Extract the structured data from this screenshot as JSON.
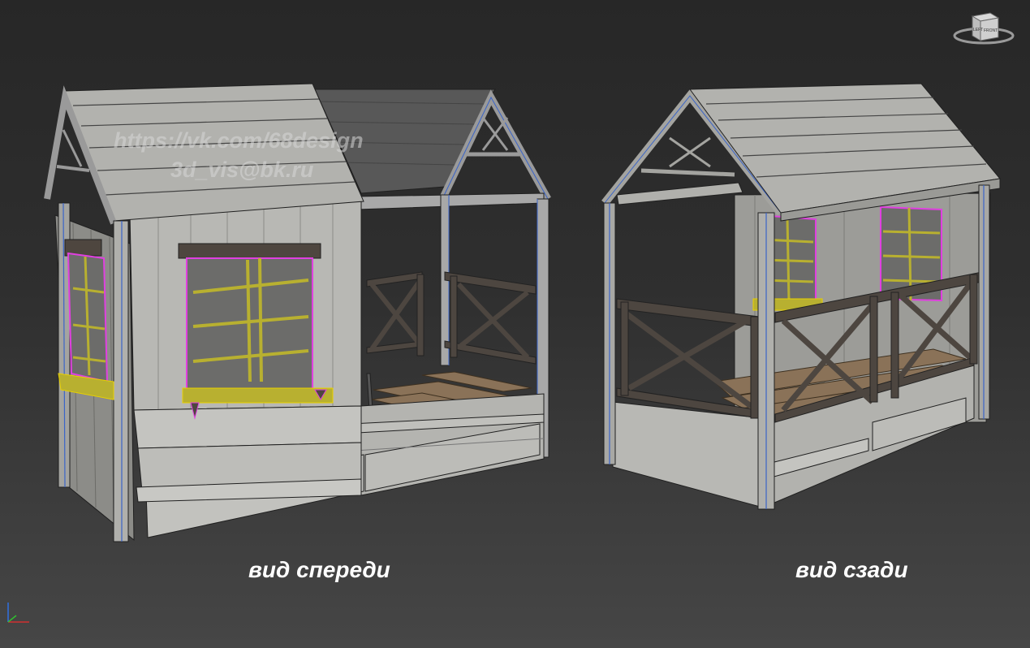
{
  "viewport": {
    "background_top": "#272727",
    "background_bottom": "#464646",
    "selection_color": "#e040e0",
    "highlight_color": "#d8d000",
    "edge_color": "#3a64c8"
  },
  "watermark": {
    "line1": "https://vk.com/68design",
    "line2": "3d_vis@bk.ru"
  },
  "captions": {
    "front": "вид спереди",
    "back": "вид сзади"
  },
  "viewcube": {
    "face_left": "LEFT",
    "face_front": "FRONT",
    "icon": "viewcube-icon"
  },
  "axis_gizmo": {
    "icon": "axis-gizmo-icon",
    "x_color": "#d03030",
    "y_color": "#30c030",
    "z_color": "#3070e0"
  }
}
